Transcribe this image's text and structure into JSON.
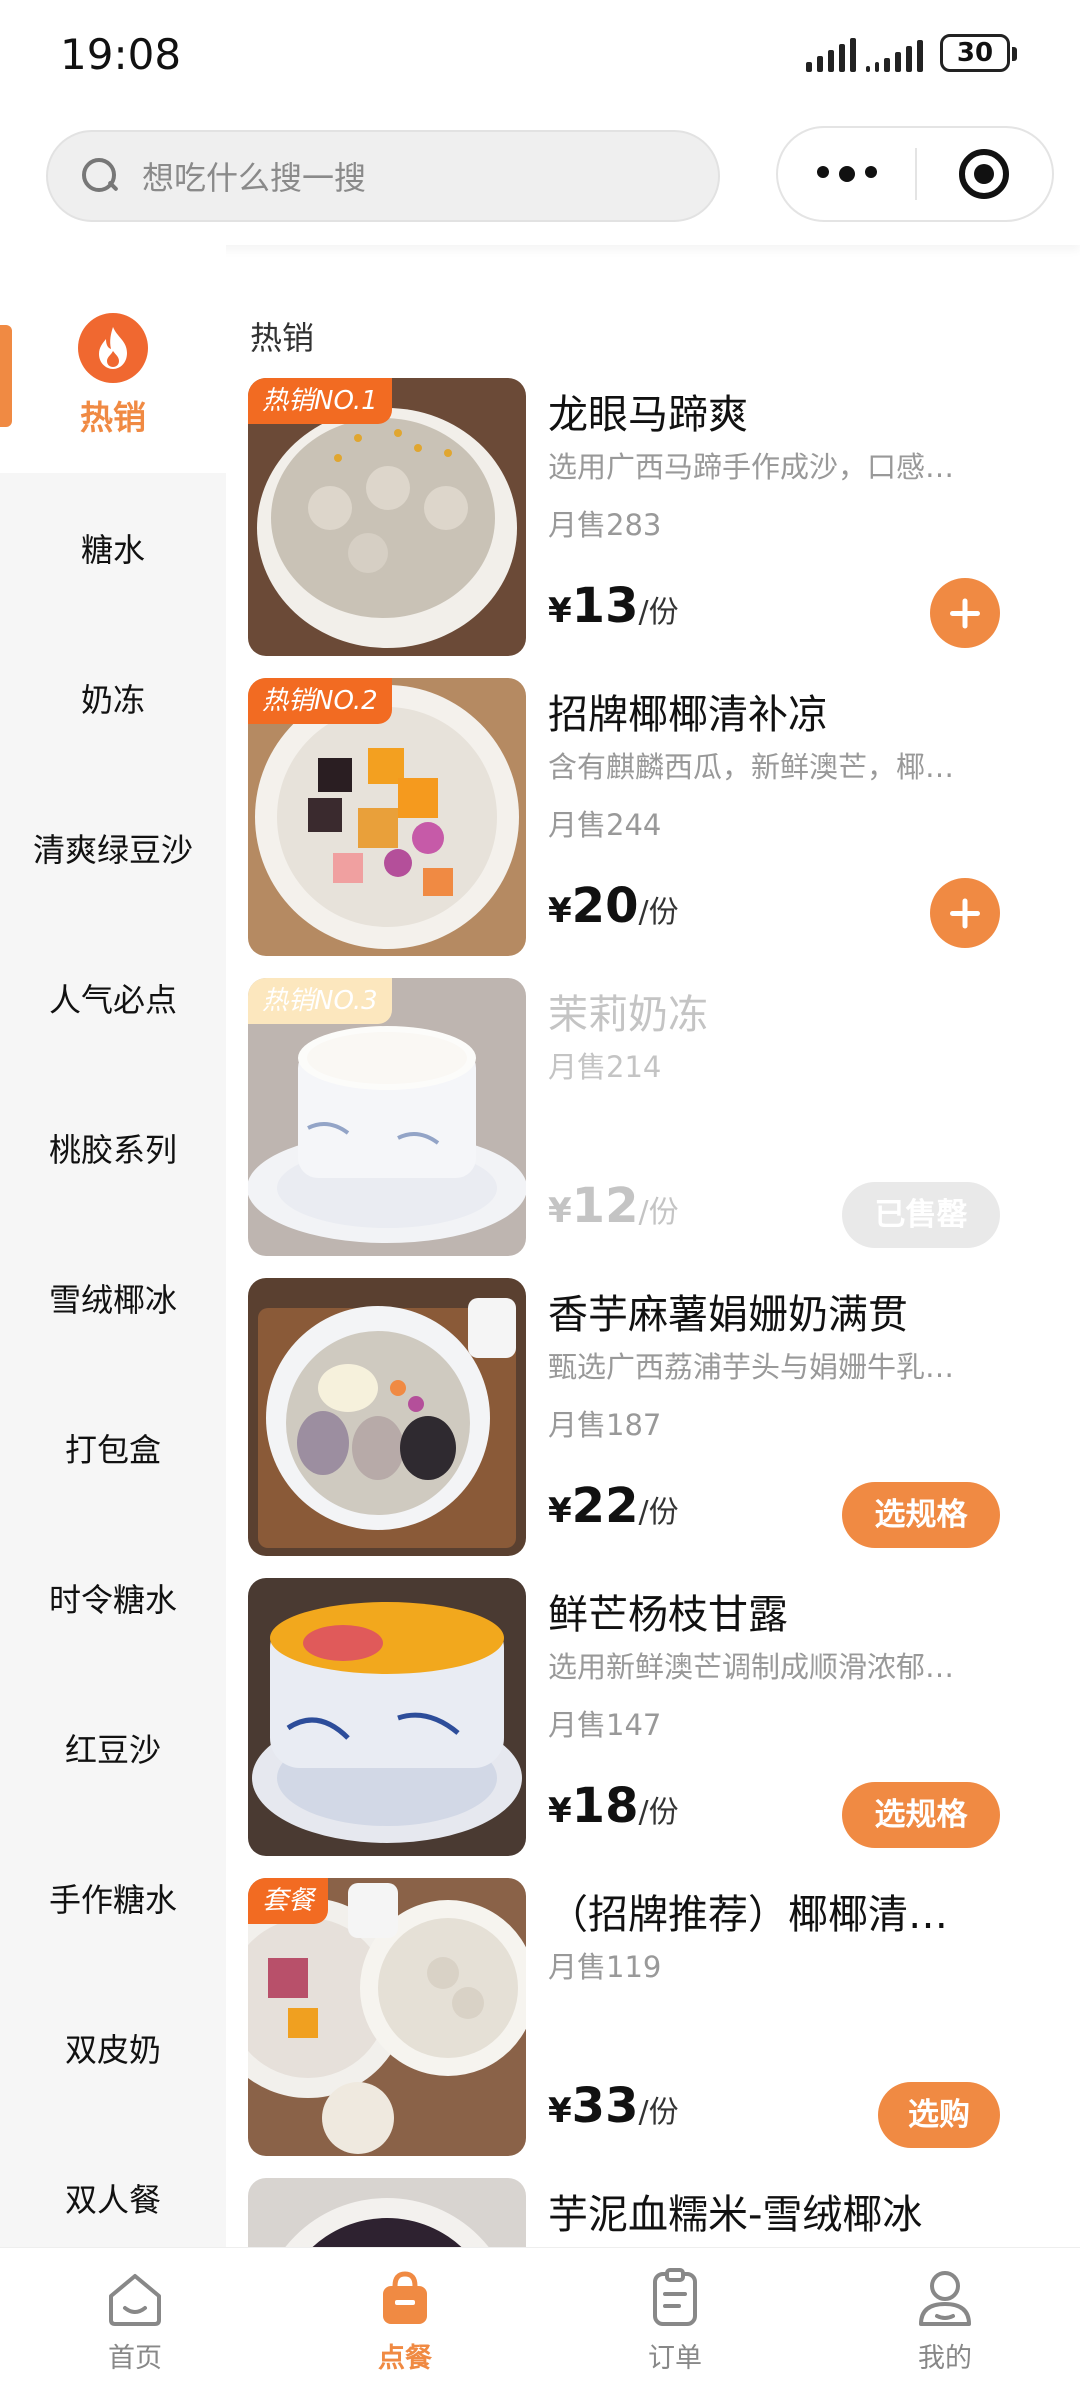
{
  "status_bar": {
    "time": "19:08",
    "battery": "30"
  },
  "search": {
    "placeholder": "想吃什么搜一搜"
  },
  "sidebar": {
    "active": "热销",
    "items": [
      "糖水",
      "奶冻",
      "清爽绿豆沙",
      "人气必点",
      "桃胶系列",
      "雪绒椰冰",
      "打包盒",
      "时令糖水",
      "红豆沙",
      "手作糖水",
      "双皮奶",
      "双人餐"
    ]
  },
  "main": {
    "section_title": "热销",
    "currency": "¥",
    "unit": "/份",
    "products": [
      {
        "name": "龙眼马蹄爽",
        "tag": "热销NO.1",
        "desc": "选用广西马蹄手作成沙，口感…",
        "sales": "月售283",
        "price": "13",
        "action": "add",
        "action_label": ""
      },
      {
        "name": "招牌椰椰清补凉",
        "tag": "热销NO.2",
        "desc": "含有麒麟西瓜，新鲜澳芒，椰…",
        "sales": "月售244",
        "price": "20",
        "action": "add",
        "action_label": ""
      },
      {
        "name": "茉莉奶冻",
        "tag": "热销NO.3",
        "desc": "",
        "sales": "月售214",
        "price": "12",
        "action": "soldout",
        "action_label": "已售罄"
      },
      {
        "name": "香芋麻薯娟姗奶满贯",
        "tag": "",
        "desc": "甄选广西荔浦芋头与娟姗牛乳…",
        "sales": "月售187",
        "price": "22",
        "action": "spec",
        "action_label": "选规格"
      },
      {
        "name": "鲜芒杨枝甘露",
        "tag": "",
        "desc": "选用新鲜澳芒调制成顺滑浓郁…",
        "sales": "月售147",
        "price": "18",
        "action": "spec",
        "action_label": "选规格"
      },
      {
        "name": "（招牌推荐）椰椰清…",
        "tag": "套餐",
        "desc": "",
        "sales": "月售119",
        "price": "33",
        "action": "buy",
        "action_label": "选购"
      },
      {
        "name": "芋泥血糯米-雪绒椰冰",
        "tag": "",
        "desc": "",
        "sales": "",
        "price": "",
        "action": "",
        "action_label": ""
      }
    ]
  },
  "tabbar": {
    "items": [
      {
        "label": "首页",
        "icon": "home-icon"
      },
      {
        "label": "点餐",
        "icon": "shopping-bag-icon"
      },
      {
        "label": "订单",
        "icon": "order-list-icon"
      },
      {
        "label": "我的",
        "icon": "user-icon"
      }
    ],
    "active": "点餐"
  },
  "colors": {
    "accent": "#f08a43",
    "tag": "#f26b22",
    "sidebar_bg": "#f6f6f6",
    "flame": "#f06830"
  }
}
